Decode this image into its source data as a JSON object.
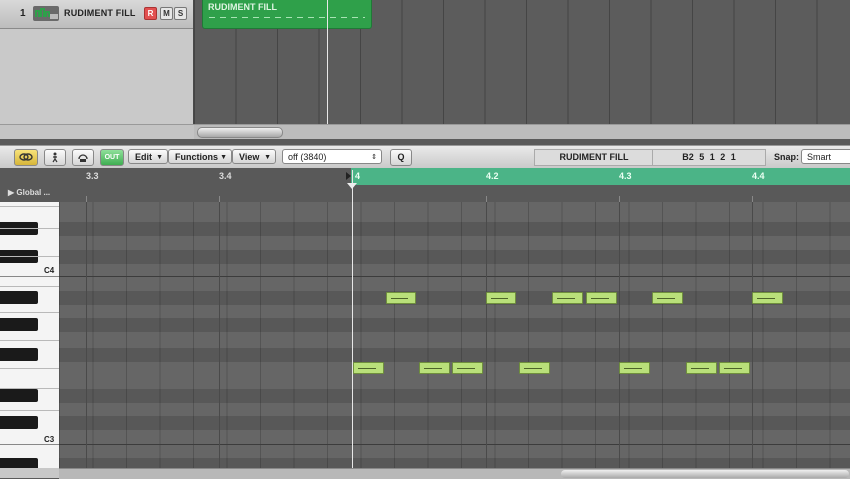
{
  "arrange": {
    "track_number": "1",
    "track_name": "RUDIMENT FILL",
    "buttons": {
      "record": "R",
      "mute": "M",
      "solo": "S"
    },
    "region_name": "RUDIMENT FILL"
  },
  "toolbar": {
    "menus": {
      "edit": "Edit",
      "functions": "Functions",
      "view": "View"
    },
    "midi_out_label": "OUT",
    "quantize_value": "off (3840)",
    "q_button": "Q",
    "region_display": "RUDIMENT FILL",
    "position_display": "B2  5 1 2 1",
    "snap_label": "Snap:",
    "snap_value": "Smart"
  },
  "ruler": {
    "global_tracks": "▶ Global ...",
    "bars": [
      "3.3",
      "3.4",
      "4",
      "4.2",
      "4.3",
      "4.4"
    ]
  },
  "keyboard": {
    "c4_label": "C4",
    "c3_label": "C3"
  },
  "notes_high_count": 6,
  "notes_low_count": 7,
  "colors": {
    "region": "#2fa04a",
    "cycle": "#4bb487",
    "note": "#b9e07a",
    "record": "#e25050"
  }
}
